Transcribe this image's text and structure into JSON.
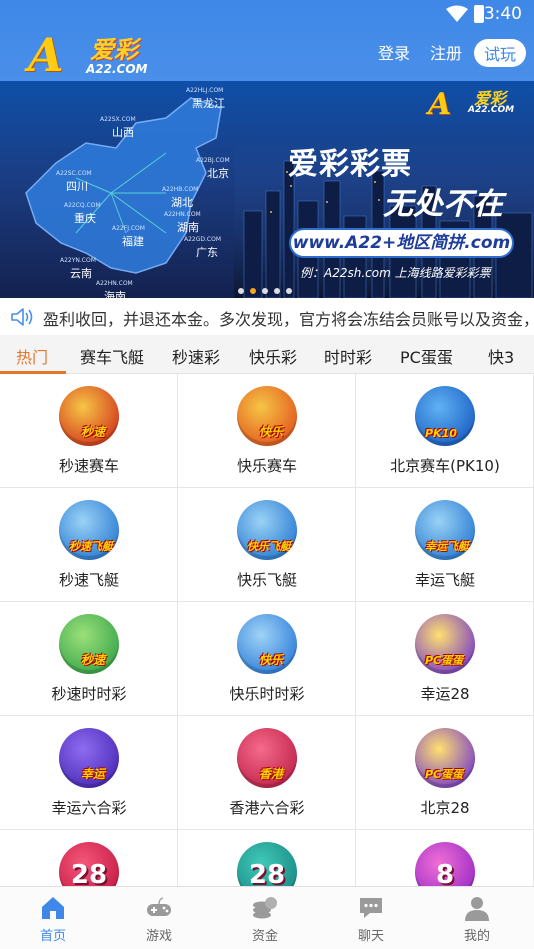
{
  "status_bar": {
    "time": "3:40"
  },
  "header": {
    "logo_mark": "A",
    "logo_cn": "爱彩",
    "logo_domain": "A22.COM",
    "login_label": "登录",
    "register_label": "注册",
    "trial_label": "试玩"
  },
  "banner": {
    "logo_mark": "A",
    "logo_cn": "爱彩",
    "logo_domain": "A22.COM",
    "title": "爱彩彩票",
    "subtitle": "无处不在",
    "url": "www.A22+地区简拼.com",
    "example": "例：A22sh.com 上海线路爱彩彩票",
    "map_regions": [
      {
        "name": "黑龙江",
        "domain": "A22HLJ.COM"
      },
      {
        "name": "山西",
        "domain": "A22SX.COM"
      },
      {
        "name": "北京",
        "domain": "A22BJ.COM"
      },
      {
        "name": "四川",
        "domain": "A22SC.COM"
      },
      {
        "name": "湖北",
        "domain": "A22HB.COM"
      },
      {
        "name": "重庆",
        "domain": "A22CQ.COM"
      },
      {
        "name": "福建",
        "domain": "A22FJ.COM"
      },
      {
        "name": "湖南",
        "domain": "A22HN.COM"
      },
      {
        "name": "广东",
        "domain": "A22GD.COM"
      },
      {
        "name": "云南",
        "domain": "A22YN.COM"
      },
      {
        "name": "海南",
        "domain": "A22HN.COM"
      }
    ],
    "carousel_total": 5,
    "carousel_active": 1
  },
  "notice": {
    "text": "盈利收回，并退还本金。多次发现，官方将会冻结会员账号以及资金，"
  },
  "tabs": [
    "热门",
    "赛车飞艇",
    "秒速彩",
    "快乐彩",
    "时时彩",
    "PC蛋蛋",
    "快3"
  ],
  "active_tab": "热门",
  "games": [
    {
      "label": "秒速赛车",
      "tag": "秒速",
      "icon": "race-car-icon",
      "colors": [
        "#f6c545",
        "#d23a1d"
      ]
    },
    {
      "label": "快乐赛车",
      "tag": "快乐",
      "icon": "race-car-icon",
      "colors": [
        "#f6c545",
        "#e2581e"
      ]
    },
    {
      "label": "北京赛车(PK10)",
      "tag": "PK10",
      "icon": "sports-car-icon",
      "colors": [
        "#5fb2f3",
        "#1c5fc4"
      ]
    },
    {
      "label": "秒速飞艇",
      "tag": "秒速飞艇",
      "icon": "jet-ski-icon",
      "colors": [
        "#9ad2f5",
        "#2b7cd3"
      ]
    },
    {
      "label": "快乐飞艇",
      "tag": "快乐飞艇",
      "icon": "jet-ski-icon",
      "colors": [
        "#9ad2f5",
        "#2b7cd3"
      ]
    },
    {
      "label": "幸运飞艇",
      "tag": "幸运飞艇",
      "icon": "jet-ski-icon",
      "colors": [
        "#9ad2f5",
        "#2b7cd3"
      ]
    },
    {
      "label": "秒速时时彩",
      "tag": "秒速",
      "icon": "clock-coins-icon",
      "colors": [
        "#9be07a",
        "#3aa64a"
      ]
    },
    {
      "label": "快乐时时彩",
      "tag": "快乐",
      "icon": "clock-coins-icon",
      "colors": [
        "#9fd3f7",
        "#2f7ed8"
      ]
    },
    {
      "label": "幸运28",
      "tag": "PC蛋蛋",
      "icon": "pc-egg-icon",
      "colors": [
        "#ffe070",
        "#7a3fc6"
      ]
    },
    {
      "label": "幸运六合彩",
      "tag": "幸运",
      "icon": "six-mark-icon",
      "colors": [
        "#8e6cf0",
        "#4b2bb8"
      ]
    },
    {
      "label": "香港六合彩",
      "tag": "香港",
      "icon": "six-mark-icon",
      "colors": [
        "#f56a8a",
        "#c0244b"
      ]
    },
    {
      "label": "北京28",
      "tag": "PC蛋蛋",
      "icon": "pc-egg-icon",
      "colors": [
        "#ffe070",
        "#7a3fc6"
      ]
    },
    {
      "label": "",
      "tag": "28",
      "icon": "number-28-icon",
      "colors": [
        "#f6567a",
        "#c41c45"
      ]
    },
    {
      "label": "",
      "tag": "28",
      "icon": "number-28-icon",
      "colors": [
        "#3fc9b7",
        "#1b8a86"
      ]
    },
    {
      "label": "",
      "tag": "8",
      "icon": "number-8-icon",
      "colors": [
        "#f06fd6",
        "#9a2bc4"
      ]
    }
  ],
  "bottom_nav": [
    {
      "label": "首页",
      "icon": "home-icon",
      "active": true
    },
    {
      "label": "游戏",
      "icon": "gamepad-icon",
      "active": false
    },
    {
      "label": "资金",
      "icon": "coins-icon",
      "active": false
    },
    {
      "label": "聊天",
      "icon": "chat-icon",
      "active": false
    },
    {
      "label": "我的",
      "icon": "user-icon",
      "active": false
    }
  ],
  "colors": {
    "primary": "#3f88e8",
    "accent": "#e4762c"
  }
}
